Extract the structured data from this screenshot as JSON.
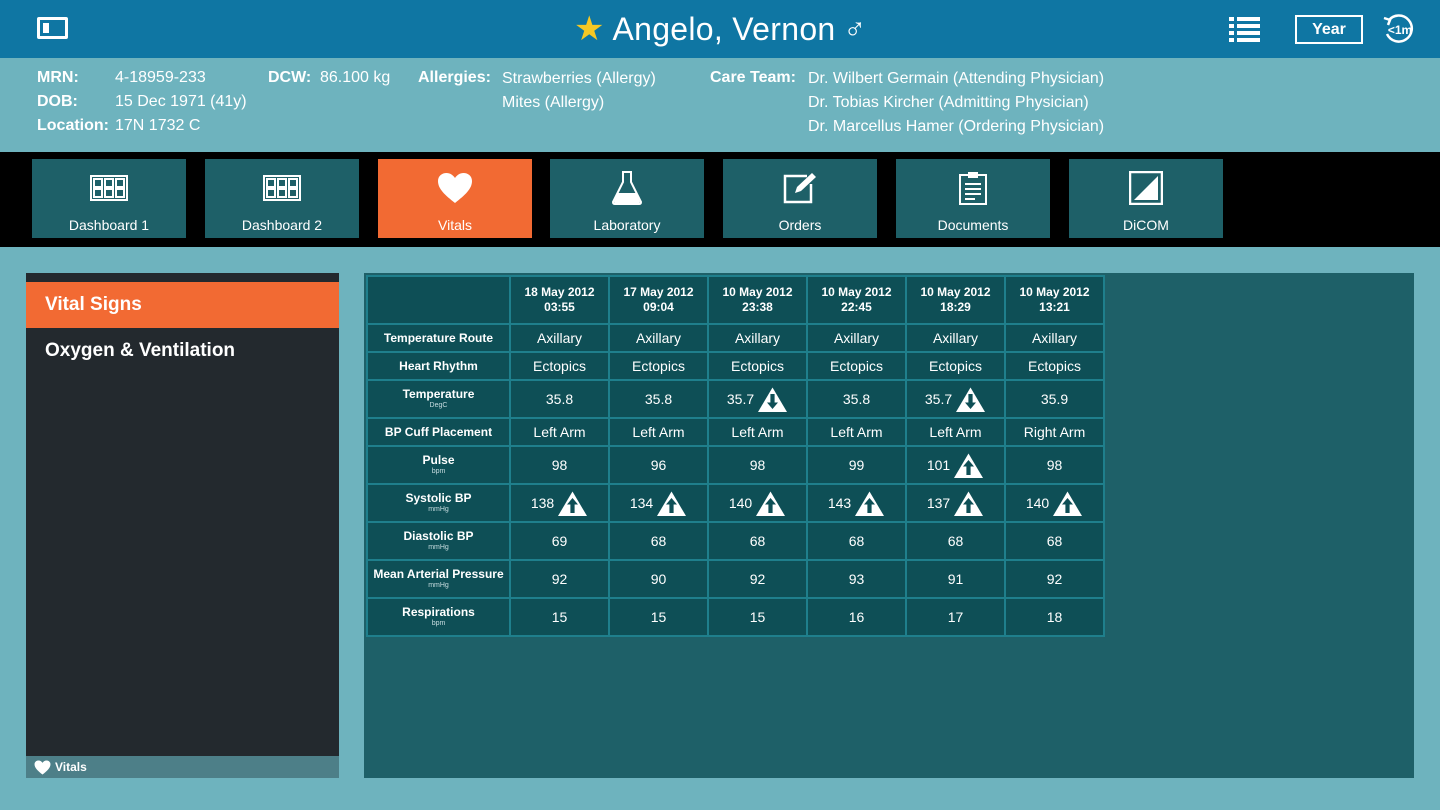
{
  "header": {
    "patient_name": "Angelo, Vernon",
    "favorite_icon": "star-icon",
    "gender_icon": "male-icon",
    "year_button": "Year",
    "refresh_label": "<1m",
    "colors": {
      "bar": "#0f76a3",
      "star": "#f6c824"
    }
  },
  "patient": {
    "mrn_label": "MRN:",
    "mrn": "4-18959-233",
    "dob_label": "DOB:",
    "dob": "15 Dec 1971 (41y)",
    "location_label": "Location:",
    "location": "17N 1732 C",
    "dcw_label": "DCW:",
    "dcw": "86.100 kg",
    "allergies_label": "Allergies:",
    "allergies": [
      "Strawberries (Allergy)",
      "Mites (Allergy)"
    ],
    "care_team_label": "Care Team:",
    "care_team": [
      "Dr. Wilbert Germain (Attending Physician)",
      "Dr. Tobias Kircher (Admitting Physician)",
      "Dr. Marcellus Hamer (Ordering Physician)"
    ]
  },
  "nav": {
    "active": "Vitals",
    "tiles": [
      {
        "label": "Dashboard 1",
        "icon": "dashboard-icon"
      },
      {
        "label": "Dashboard 2",
        "icon": "dashboard-icon"
      },
      {
        "label": "Vitals",
        "icon": "heart-icon"
      },
      {
        "label": "Laboratory",
        "icon": "flask-icon"
      },
      {
        "label": "Orders",
        "icon": "edit-icon"
      },
      {
        "label": "Documents",
        "icon": "clipboard-icon"
      },
      {
        "label": "DiCOM",
        "icon": "image-icon"
      }
    ],
    "colors": {
      "tile": "#1e6068",
      "active": "#f26a33"
    }
  },
  "left_panel": {
    "items": [
      "Vital Signs",
      "Oxygen & Ventilation"
    ],
    "selected": "Vital Signs",
    "footer": "Vitals"
  },
  "vitals": {
    "dates": [
      {
        "date": "18 May 2012",
        "time": "03:55"
      },
      {
        "date": "17 May 2012",
        "time": "09:04"
      },
      {
        "date": "10 May 2012",
        "time": "23:38"
      },
      {
        "date": "10 May 2012",
        "time": "22:45"
      },
      {
        "date": "10 May 2012",
        "time": "18:29"
      },
      {
        "date": "10 May 2012",
        "time": "13:21"
      }
    ],
    "rows": [
      {
        "name": "Temperature Route",
        "unit": "",
        "size": "short",
        "values": [
          "Axillary",
          "Axillary",
          "Axillary",
          "Axillary",
          "Axillary",
          "Axillary"
        ],
        "flags": [
          "",
          "",
          "",
          "",
          "",
          ""
        ]
      },
      {
        "name": "Heart Rhythm",
        "unit": "",
        "size": "short",
        "values": [
          "Ectopics",
          "Ectopics",
          "Ectopics",
          "Ectopics",
          "Ectopics",
          "Ectopics"
        ],
        "flags": [
          "",
          "",
          "",
          "",
          "",
          ""
        ]
      },
      {
        "name": "Temperature",
        "unit": "DegC",
        "size": "tall",
        "values": [
          "35.8",
          "35.8",
          "35.7",
          "35.8",
          "35.7",
          "35.9"
        ],
        "flags": [
          "",
          "",
          "low",
          "",
          "low",
          ""
        ]
      },
      {
        "name": "BP Cuff Placement",
        "unit": "",
        "size": "short",
        "values": [
          "Left Arm",
          "Left Arm",
          "Left Arm",
          "Left Arm",
          "Left Arm",
          "Right Arm"
        ],
        "flags": [
          "",
          "",
          "",
          "",
          "",
          ""
        ]
      },
      {
        "name": "Pulse",
        "unit": "bpm",
        "size": "tall",
        "values": [
          "98",
          "96",
          "98",
          "99",
          "101",
          "98"
        ],
        "flags": [
          "",
          "",
          "",
          "",
          "high",
          ""
        ]
      },
      {
        "name": "Systolic BP",
        "unit": "mmHg",
        "size": "tall",
        "values": [
          "138",
          "134",
          "140",
          "143",
          "137",
          "140"
        ],
        "flags": [
          "high",
          "high",
          "high",
          "high",
          "high",
          "high"
        ]
      },
      {
        "name": "Diastolic BP",
        "unit": "mmHg",
        "size": "tall",
        "values": [
          "69",
          "68",
          "68",
          "68",
          "68",
          "68"
        ],
        "flags": [
          "",
          "",
          "",
          "",
          "",
          ""
        ]
      },
      {
        "name": "Mean Arterial Pressure",
        "unit": "mmHg",
        "size": "tall",
        "values": [
          "92",
          "90",
          "92",
          "93",
          "91",
          "92"
        ],
        "flags": [
          "",
          "",
          "",
          "",
          "",
          ""
        ]
      },
      {
        "name": "Respirations",
        "unit": "bpm",
        "size": "tall",
        "values": [
          "15",
          "15",
          "15",
          "16",
          "17",
          "18"
        ],
        "flags": [
          "",
          "",
          "",
          "",
          "",
          ""
        ]
      }
    ]
  }
}
